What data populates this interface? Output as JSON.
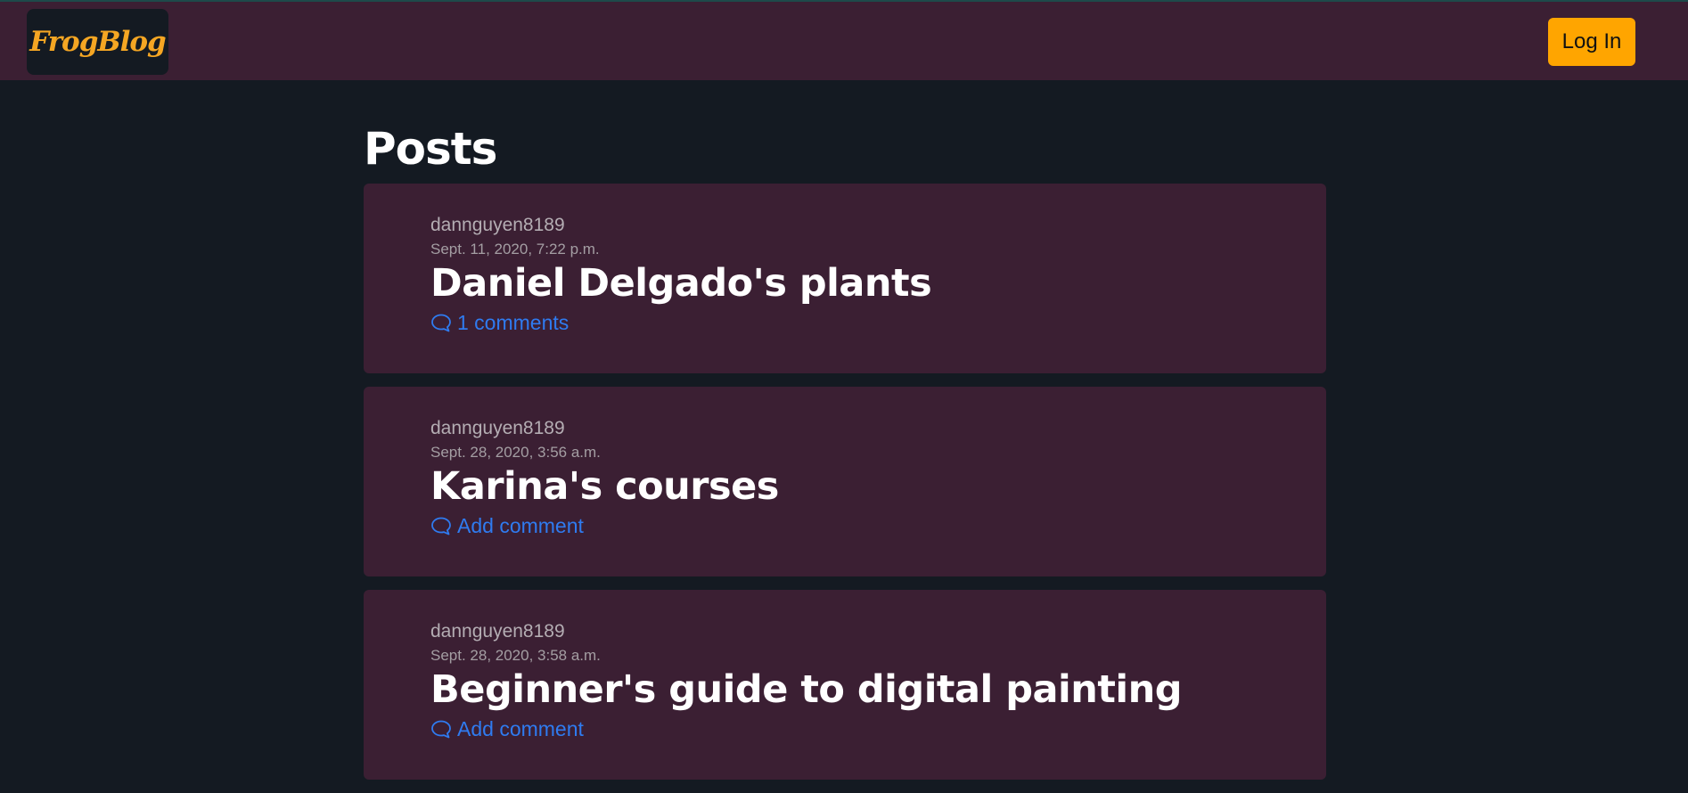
{
  "navbar": {
    "brand": "FrogBlog",
    "login_label": "Log In"
  },
  "main": {
    "title": "Posts",
    "posts": [
      {
        "author": "dannguyen8189",
        "date": "Sept. 11, 2020, 7:22 p.m.",
        "title": "Daniel Delgado's plants",
        "comments_label": "1 comments"
      },
      {
        "author": "dannguyen8189",
        "date": "Sept. 28, 2020, 3:56 a.m.",
        "title": "Karina's courses",
        "comments_label": "Add comment"
      },
      {
        "author": "dannguyen8189",
        "date": "Sept. 28, 2020, 3:58 a.m.",
        "title": "Beginner's guide to digital painting",
        "comments_label": "Add comment"
      }
    ]
  },
  "icons": {
    "comment": "speech-bubble-outline"
  },
  "colors": {
    "background": "#141a22",
    "navbar": "#3b1f33",
    "card": "#3b1f33",
    "brand": "#f5a623",
    "login_button": "#ffa500",
    "link": "#2f7bf0"
  }
}
